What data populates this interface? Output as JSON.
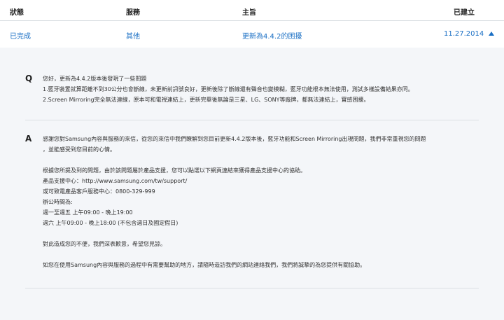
{
  "table": {
    "headers": {
      "status": "狀態",
      "service": "服務",
      "subject": "主旨",
      "created": "已建立"
    },
    "row": {
      "status": "已完成",
      "service": "其他",
      "subject": "更新為4.4.2的困擾",
      "created": "11.27.2014"
    }
  },
  "question": {
    "label": "Q",
    "lines": [
      "您好，更新為4.4.2版本後發現了一些問題",
      "1.藍牙裝置就算距離不到30公分也會斷線，未更新前訊號良好，更新後除了斷線還有聲音也變模糊，藍牙功能根本無法使用，測試多樣設備結果亦同。",
      "2.Screen Mirroring完全無法連線，原本可和電視連結上，更新完畢後無論是三星、LG、SONY等廠牌，都無法連結上，實感困擾。"
    ]
  },
  "answer": {
    "label": "A",
    "lines": [
      "感謝您對Samsung內容與服務的來信，從您的來信中我們瞭解到您目前更新4.4.2版本後，藍牙功能和Screen Mirroring出現問題，我們非常重視您的問題",
      "，並能感受到您目前的心情。",
      "",
      "根據您所提及到的問題，由於該問題屬於產品支援，您可以點選以下網頁連結來獲得產品支援中心的協助。",
      " 產品支援中心：http://www.samsung.com/tw/support/",
      " 或可致電產品客戶服務中心：0800-329-999",
      "辦公時間為:",
      "週一至週五 上午09:00 - 晚上19:00",
      "週六 上午09:00 - 晚上18:00 (不包含週日及國定假日)",
      "",
      "對此造成您的不便，我們深表歉意，希望您見諒。",
      "",
      "如您在使用Samsung內容與服務的過程中有需要幫助的地方，請隨時造訪我們的網站連絡我們，我們將誠摯的為您提供有關協助。"
    ]
  }
}
